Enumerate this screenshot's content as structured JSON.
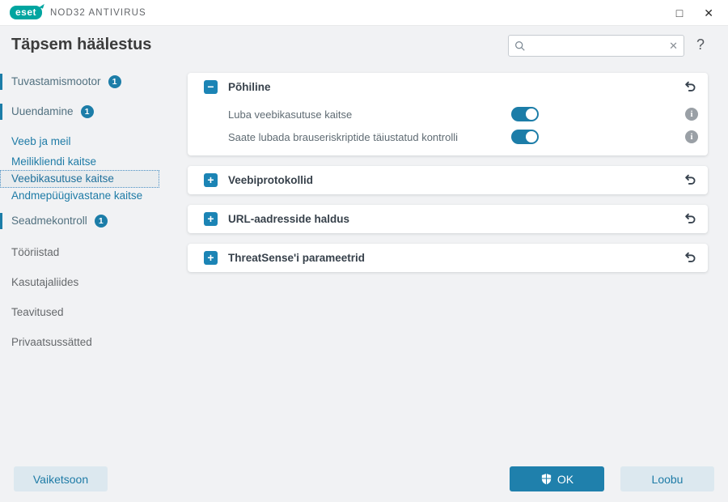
{
  "window": {
    "brand": "eset",
    "title": "NOD32 ANTIVIRUS",
    "controls": {
      "maximize": "□",
      "close": "✕"
    }
  },
  "header": {
    "title": "Täpsem häälestus",
    "search": {
      "value": "",
      "placeholder": "",
      "clear_icon": "✕"
    },
    "help": "?"
  },
  "sidebar": {
    "items": [
      {
        "label": "Tuvastamismootor",
        "badge": "1",
        "type": "changed"
      },
      {
        "label": "Uuendamine",
        "badge": "1",
        "type": "changed"
      },
      {
        "label": "Veeb ja meil",
        "type": "link"
      },
      {
        "label": "Meilikliendi kaitse",
        "type": "link"
      },
      {
        "label": "Veebikasutuse kaitse",
        "type": "selected"
      },
      {
        "label": "Andmepüügivastane kaitse",
        "type": "link"
      },
      {
        "label": "Seadmekontroll",
        "badge": "1",
        "type": "changed"
      },
      {
        "label": "Tööriistad",
        "type": "plain"
      },
      {
        "label": "Kasutajaliides",
        "type": "plain"
      },
      {
        "label": "Teavitused",
        "type": "plain"
      },
      {
        "label": "Privaatsussätted",
        "type": "plain"
      }
    ]
  },
  "panels": [
    {
      "title": "Põhiline",
      "expanded": true,
      "expander_icon": "−",
      "rows": [
        {
          "label": "Luba veebikasutuse kaitse",
          "toggle_on": true
        },
        {
          "label": "Saate lubada brauseriskriptide täiustatud kontrolli",
          "toggle_on": true
        }
      ]
    },
    {
      "title": "Veebiprotokollid",
      "expanded": false,
      "expander_icon": "+"
    },
    {
      "title": "URL-aadresside haldus",
      "expanded": false,
      "expander_icon": "+"
    },
    {
      "title": "ThreatSense'i parameetrid",
      "expanded": false,
      "expander_icon": "+"
    }
  ],
  "icons": {
    "info": "i"
  },
  "footer": {
    "default_label": "Vaiketsoon",
    "ok_label": "OK",
    "cancel_label": "Loobu"
  },
  "colors": {
    "accent": "#1f80ac",
    "logo_teal": "#00a5a0",
    "badge": "#1c7da8",
    "toggle_on": "#1c7da8",
    "window_bg": "#f1f2f4",
    "light_button_bg": "#dce8ef"
  }
}
